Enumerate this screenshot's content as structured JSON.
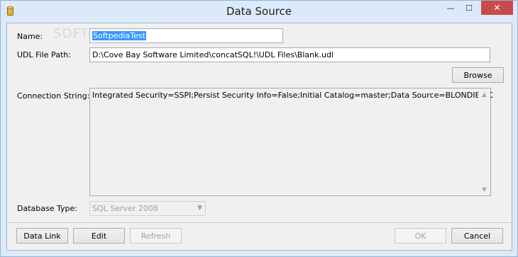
{
  "window": {
    "title": "Data Source",
    "minimize_glyph": "—",
    "maximize_glyph": "☐",
    "close_glyph": "✕"
  },
  "form": {
    "name_label": "Name:",
    "name_value": "SoftpediaTest",
    "udl_label": "UDL File Path:",
    "udl_value": "D:\\Cove Bay Software Limited\\concatSQL!\\UDL Files\\Blank.udl",
    "browse_label": "Browse",
    "conn_label": "Connection String:",
    "conn_value": "Integrated Security=SSPI;Persist Security Info=False;Initial Catalog=master;Data Source=BLONDIE-PC",
    "dbtype_label": "Database Type:",
    "dbtype_value": "SQL Server 2008"
  },
  "footer": {
    "data_link_label": "Data Link",
    "edit_label": "Edit",
    "refresh_label": "Refresh",
    "ok_label": "OK",
    "cancel_label": "Cancel"
  },
  "watermark": "SOFTPEDIA",
  "colors": {
    "close_button": "#c74b4b",
    "selection": "#3399ff",
    "frame": "#dbe9f8"
  }
}
